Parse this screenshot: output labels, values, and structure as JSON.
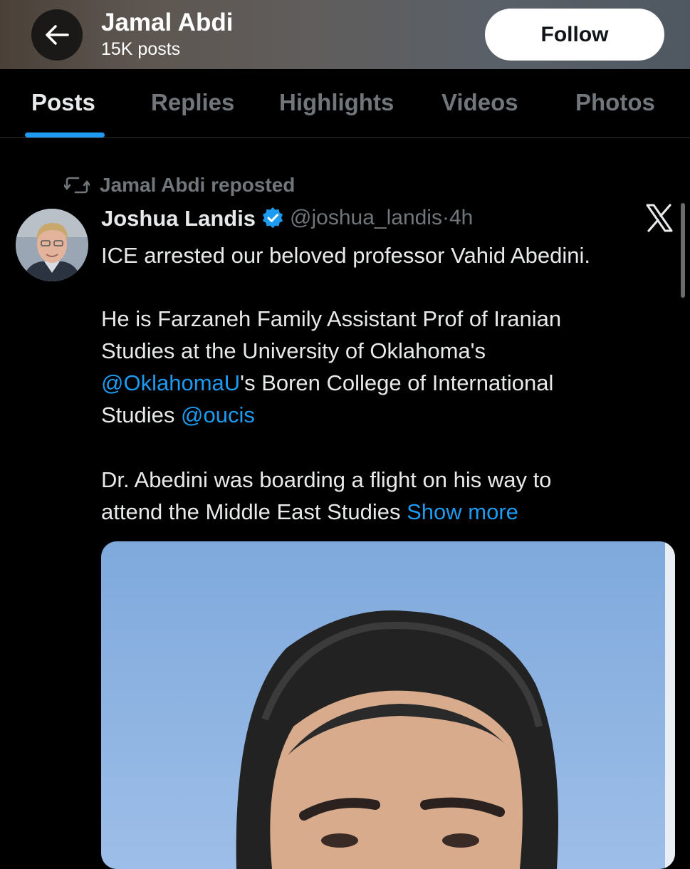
{
  "header": {
    "name": "Jamal Abdi",
    "post_count": "15K posts",
    "follow_label": "Follow",
    "back_icon": "arrow-left-icon"
  },
  "tabs": [
    {
      "label": "Posts",
      "active": true
    },
    {
      "label": "Replies",
      "active": false
    },
    {
      "label": "Highlights",
      "active": false
    },
    {
      "label": "Videos",
      "active": false
    },
    {
      "label": "Photos",
      "active": false
    }
  ],
  "post": {
    "repost_label": "Jamal Abdi reposted",
    "author_name": "Joshua Landis",
    "handle": "@joshua_landis",
    "dot": "·",
    "time": "4h",
    "line1": "ICE arrested our beloved professor Vahid Abedini.",
    "line2": "He is Farzaneh Family Assistant Prof of Iranian",
    "line3": "Studies at the University of Oklahoma's",
    "mention1": "@OklahomaU",
    "line4_rest": "'s Boren College of International",
    "line5_start": "Studies ",
    "mention2": "@oucis",
    "line6": "Dr. Abedini was boarding a flight on his way to",
    "line7_start": "attend the Middle East Studies ",
    "show_more": "Show more"
  },
  "colors": {
    "background": "#000000",
    "accent": "#1d9bf0",
    "muted": "#71767b",
    "text": "#e7e9ea"
  },
  "icons": [
    "arrow-left-icon",
    "repost-icon",
    "verified-badge-icon",
    "x-logo-icon"
  ]
}
